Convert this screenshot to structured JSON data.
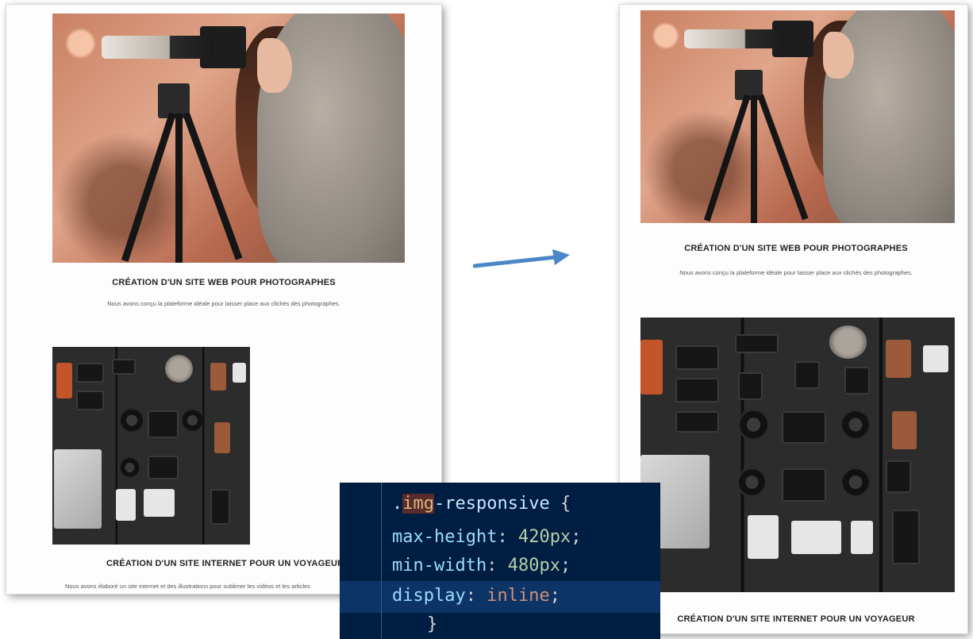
{
  "left_panel": {
    "card1": {
      "title": "CRÉATION D'UN SITE WEB POUR PHOTOGRAPHES",
      "description": "Nous avons conçu la plateforme idéale pour laisser place aux clichés des photographes."
    },
    "card2": {
      "title": "CRÉATION D'UN SITE INTERNET POUR UN VOYAGEUR",
      "description": "Nous avons élaboré un site internet et des illustrations pour sublimer les vidéos et les articles"
    }
  },
  "right_panel": {
    "card1": {
      "title": "CRÉATION D'UN SITE WEB POUR PHOTOGRAPHES",
      "description": "Nous avons conçu la plateforme idéale pour laisser place aux clichés des photographes."
    },
    "card2": {
      "title": "CRÉATION D'UN SITE INTERNET POUR UN VOYAGEUR"
    }
  },
  "code": {
    "selector_prefix": ".",
    "selector_highlight": "img",
    "selector_rest": "-responsive",
    "open_brace": " {",
    "line1_prop": "max-height",
    "line1_value": "420px",
    "line2_prop": "min-width",
    "line2_value": "480px",
    "line3_prop": "display",
    "line3_value": "inline",
    "close_brace": "}"
  },
  "colors": {
    "arrow": "#4a86c8",
    "code_background": "#001e42",
    "title_text": "#222222"
  },
  "icons": [
    "right-arrow-icon"
  ]
}
